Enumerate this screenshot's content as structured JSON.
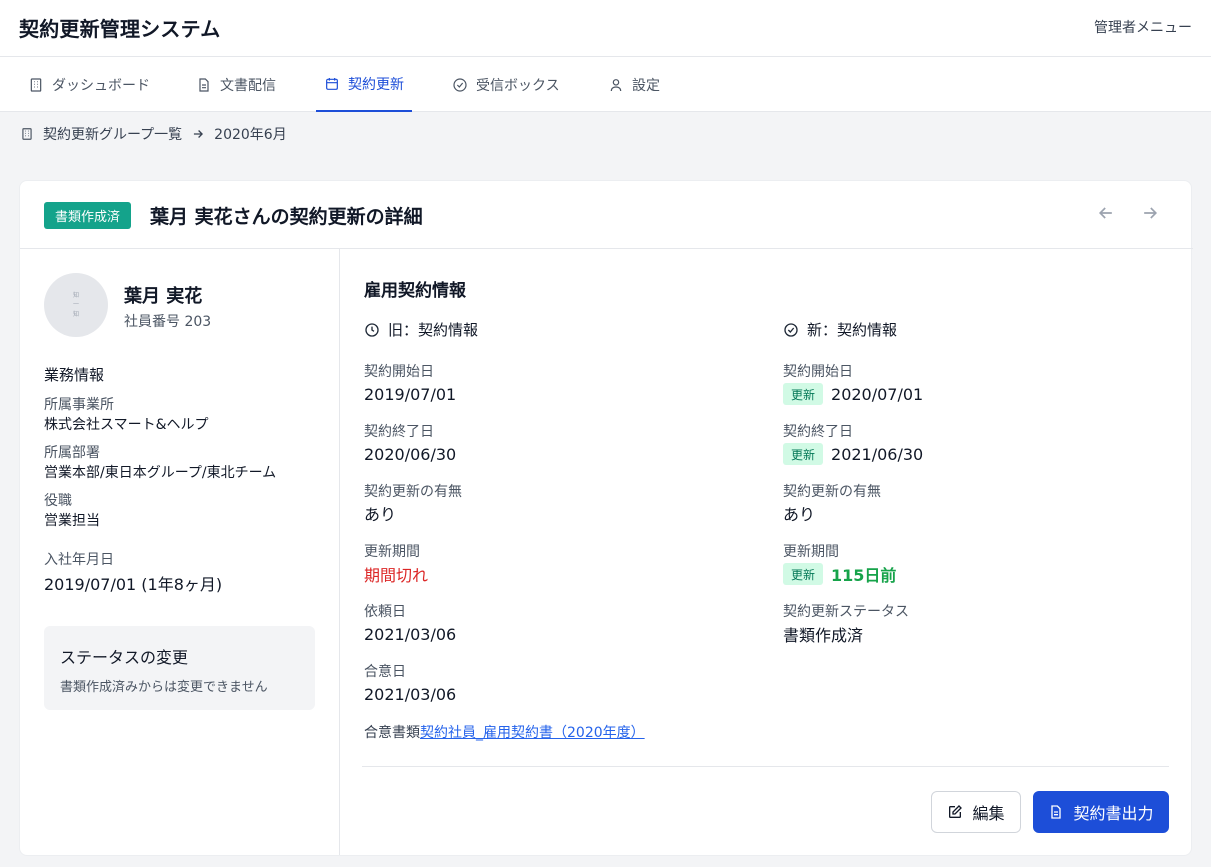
{
  "app": {
    "title": "契約更新管理システム",
    "admin_menu": "管理者メニュー"
  },
  "tabs": [
    {
      "label": "ダッシュボード",
      "icon": "building-icon"
    },
    {
      "label": "文書配信",
      "icon": "document-icon"
    },
    {
      "label": "契約更新",
      "icon": "calendar-icon",
      "active": true
    },
    {
      "label": "受信ボックス",
      "icon": "check-circle-icon"
    },
    {
      "label": "設定",
      "icon": "user-icon"
    }
  ],
  "breadcrumb": {
    "parent": "契約更新グループ一覧",
    "current": "2020年6月"
  },
  "card": {
    "status_badge": "書類作成済",
    "title": "葉月 実花さんの契約更新の詳細"
  },
  "employee": {
    "avatar_text": [
      "知",
      "一",
      "知"
    ],
    "name": "葉月 実花",
    "number": "社員番号 203",
    "business_heading": "業務情報",
    "office_label": "所属事業所",
    "office_value": "株式会社スマート&ヘルプ",
    "dept_label": "所属部署",
    "dept_value": "営業本部/東日本グループ/東北チーム",
    "position_label": "役職",
    "position_value": "営業担当",
    "hire_label": "入社年月日",
    "hire_value": "2019/07/01 (1年8ヶ月)"
  },
  "status_change": {
    "title": "ステータスの変更",
    "desc": "書類作成済みからは変更できません"
  },
  "contract": {
    "heading": "雇用契約情報",
    "old": {
      "heading": "旧：契約情報",
      "start_label": "契約開始日",
      "start_value": "2019/07/01",
      "end_label": "契約終了日",
      "end_value": "2020/06/30",
      "renew_label": "契約更新の有無",
      "renew_value": "あり",
      "period_label": "更新期間",
      "period_value": "期間切れ",
      "request_label": "依頼日",
      "request_value": "2021/03/06",
      "agree_label": "合意日",
      "agree_value": "2021/03/06"
    },
    "new": {
      "heading": "新：契約情報",
      "update_badge": "更新",
      "start_label": "契約開始日",
      "start_value": "2020/07/01",
      "end_label": "契約終了日",
      "end_value": "2021/06/30",
      "renew_label": "契約更新の有無",
      "renew_value": "あり",
      "period_label": "更新期間",
      "period_value": "115日前",
      "status_label": "契約更新ステータス",
      "status_value": "書類作成済"
    },
    "agree_doc_label": "合意書類",
    "agree_doc_link": "契約社員_雇用契約書（2020年度）"
  },
  "actions": {
    "edit": "編集",
    "export": "契約書出力"
  },
  "colors": {
    "accent": "#1d4ed8",
    "badge_teal": "#14a38b",
    "update_bg": "#d1fae5",
    "expired": "#dc2626",
    "days_green": "#16a34a"
  }
}
